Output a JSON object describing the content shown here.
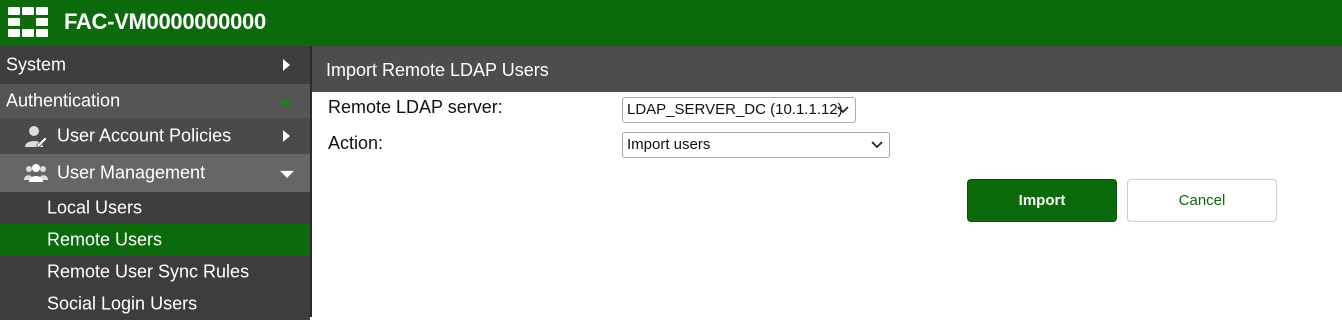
{
  "header": {
    "title": "FAC-VM0000000000",
    "logo_icon": "fortinet-logo-icon",
    "bg_color": "#0b6b0b"
  },
  "sidebar": {
    "system": {
      "label": "System",
      "icon": "chevron-right-icon"
    },
    "authentication": {
      "label": "Authentication",
      "icon": "chevron-down-icon"
    },
    "user_account_policies": {
      "label": "User Account Policies",
      "icon": "user-edit-icon"
    },
    "user_management": {
      "label": "User Management",
      "icon": "users-icon"
    },
    "items": [
      {
        "label": "Local Users"
      },
      {
        "label": "Remote Users",
        "active": true
      },
      {
        "label": "Remote User Sync Rules"
      },
      {
        "label": "Social Login Users"
      }
    ],
    "active_color": "#0b6b0b"
  },
  "content": {
    "title": "Import Remote LDAP Users",
    "server_label": "Remote LDAP server:",
    "server_value": "LDAP_SERVER_DC (10.1.1.12)",
    "action_label": "Action:",
    "action_value": "Import users",
    "import_button": "Import",
    "cancel_button": "Cancel"
  }
}
